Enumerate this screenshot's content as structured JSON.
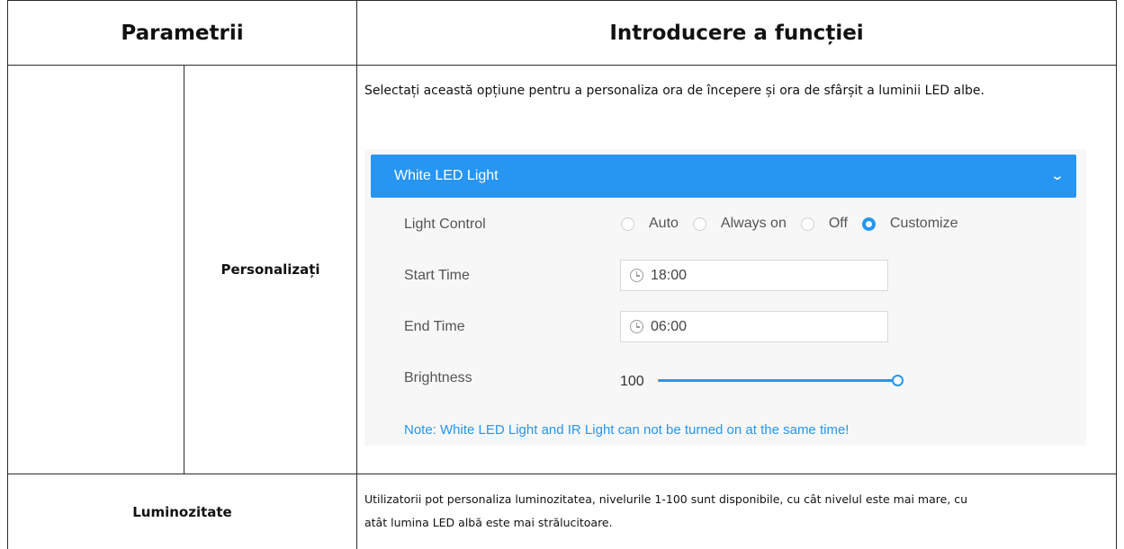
{
  "table": {
    "header": {
      "param_col": "Parametrii",
      "intro_col": "Introducere a funcției"
    },
    "rows": [
      {
        "param": "Personalizați",
        "description": "Selectați această opțiune pentru a personaliza ora de începere și ora de sfârșit a luminii LED albe."
      },
      {
        "param": "Luminozitate",
        "description_line1": "Utilizatorii pot personaliza luminozitatea, nivelurile 1-100 sunt disponibile, cu cât nivelul este mai mare, cu",
        "description_line2": "atât lumina LED albă este mai strălucitoare."
      }
    ]
  },
  "panel": {
    "title": "White LED Light",
    "header_color": "#2795f2",
    "expand_icon": "chevron-down-icon",
    "light_control": {
      "label": "Light Control",
      "options": [
        "Auto",
        "Always on",
        "Off",
        "Customize"
      ],
      "selected": "Customize"
    },
    "start_time": {
      "label": "Start Time",
      "value": "18:00",
      "icon": "clock-icon"
    },
    "end_time": {
      "label": "End Time",
      "value": "06:00",
      "icon": "clock-icon"
    },
    "brightness": {
      "label": "Brightness",
      "value": "100",
      "level": 1.0
    },
    "note": "Note: White LED Light and IR Light can not be turned on at the same time!"
  }
}
